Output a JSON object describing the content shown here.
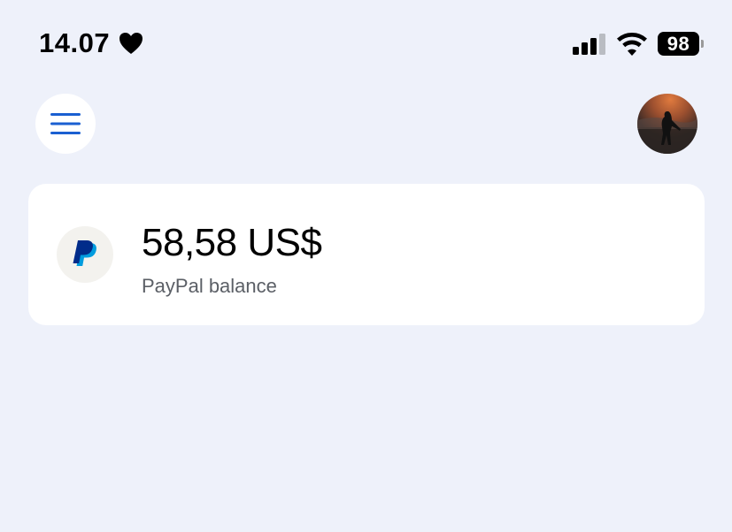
{
  "status_bar": {
    "time": "14.07",
    "battery": "98",
    "icons": [
      "heart-icon",
      "signal-icon",
      "wifi-icon",
      "battery-icon"
    ]
  },
  "header": {
    "menu_icon": "hamburger-icon",
    "avatar": "profile-avatar"
  },
  "balance_card": {
    "amount": "58,58 US$",
    "label": "PayPal balance",
    "logo": "paypal-logo-icon"
  },
  "colors": {
    "background": "#eef1fa",
    "card": "#ffffff",
    "accent_blue": "#1a5fd1",
    "paypal_dark_blue": "#002c8a",
    "paypal_light_blue": "#009cde",
    "label_gray": "#5b5f66"
  }
}
